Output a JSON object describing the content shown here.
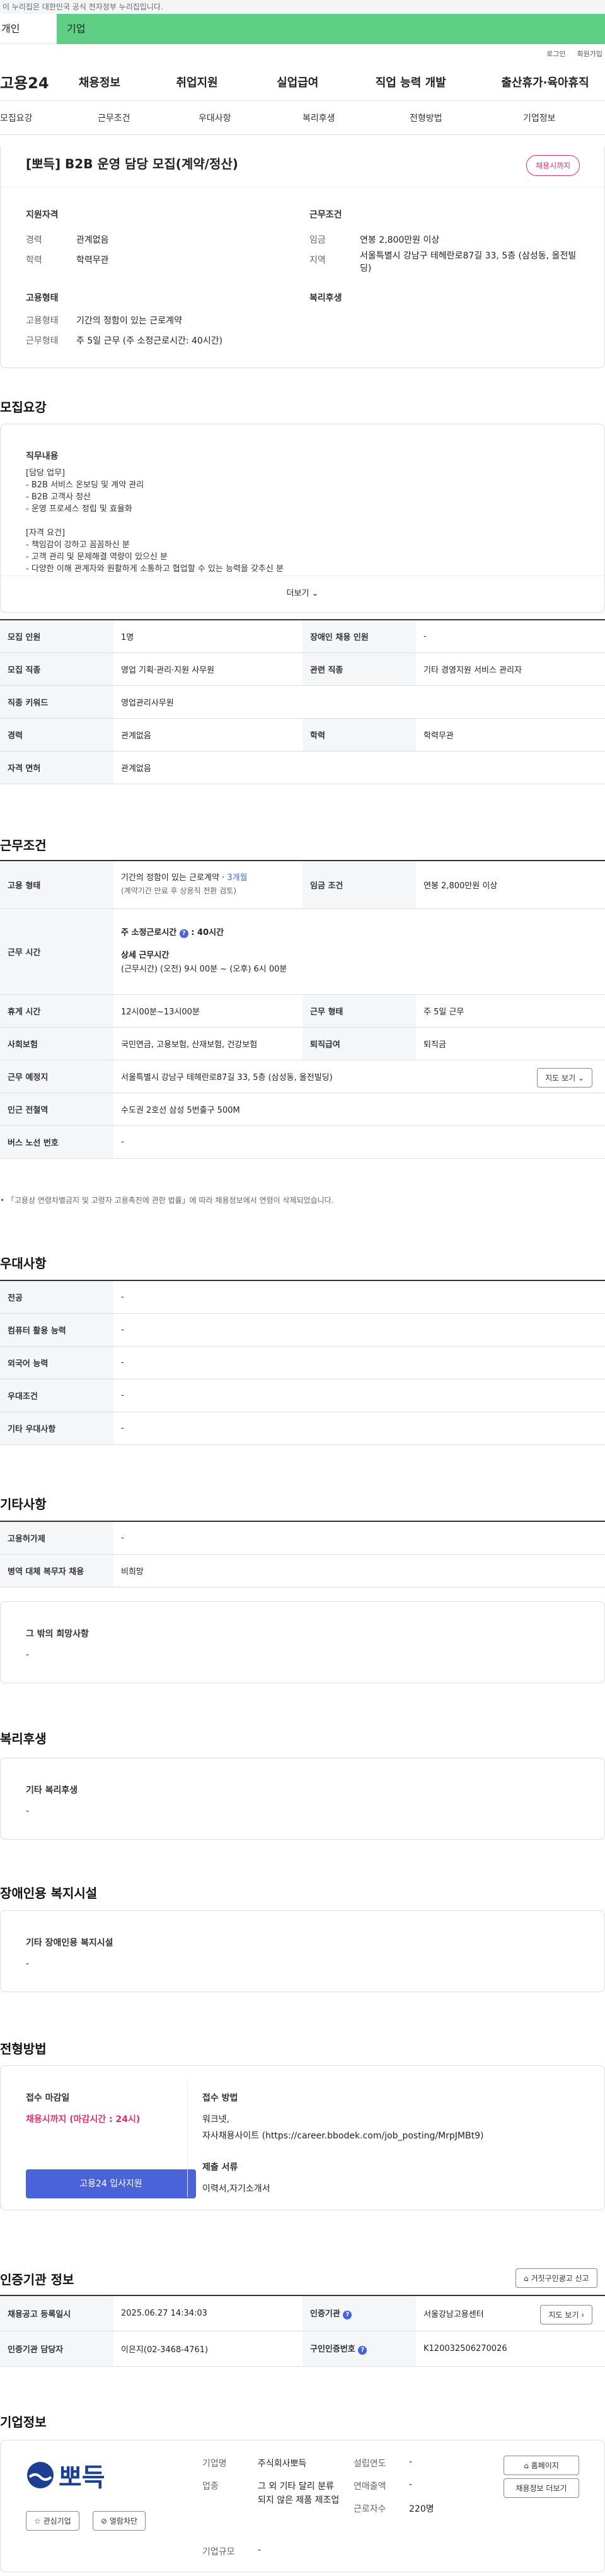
{
  "gov_banner": "이 누리집은 대한민국 공식 전자정부 누리집입니다.",
  "tabs": {
    "individual": "개인",
    "enterprise": "기업"
  },
  "util": {
    "login": "로그인",
    "signup": "회원가입"
  },
  "gnb": {
    "logo": "고용24",
    "items": [
      "채용정보",
      "취업지원",
      "실업급여",
      "직업 능력 개발",
      "출산휴가·육아휴직"
    ]
  },
  "subnav": [
    "모집요강",
    "근무조건",
    "우대사항",
    "복리후생",
    "전형방법",
    "기업정보"
  ],
  "summary": {
    "title": "[뽀득] B2B 운영 담당 모집(계약/정산)",
    "badge": "채용시까지",
    "qual_label": "지원자격",
    "exp_key": "경력",
    "exp_val": "관계없음",
    "edu_key": "학력",
    "edu_val": "학력무관",
    "cond_label": "근무조건",
    "wage_key": "임금",
    "wage_val": "연봉 2,800만원 이상",
    "loc_key": "지역",
    "loc_val": "서울특별시 강남구 테헤란로87길 33, 5층 (삼성동, 올전빌딩)",
    "emp_label": "고용형태",
    "type_key": "고용형태",
    "type_val": "기간의 정함이 있는 근로계약",
    "form_key": "근무형태",
    "form_val": "주 5일 근무 (주 소정근로시간: 40시간)",
    "welfare_label": "복리후생"
  },
  "recruit": {
    "title": "모집요강",
    "duty_label": "직무내용",
    "lines": [
      "[담당 업무]",
      "- B2B 서비스 온보딩 및 계약 관리",
      "- B2B 고객사 정산",
      "- 운영 프로세스 정립 및 효율화",
      "",
      "[자격 요건]",
      "- 책임감이 강하고 꼼꼼하신 분",
      "- 고객 관리 및 문제해결 역량이 있으신 분",
      "- 다양한 이해 관계자와 원활하게 소통하고 협업할 수 있는 능력을 갖추신 분"
    ],
    "more": "더보기",
    "rows": [
      {
        "k1": "모집 인원",
        "v1": "1명",
        "k2": "장애인 채용 인원",
        "v2": "-"
      },
      {
        "k1": "모집 직종",
        "v1": "영업 기획·관리·지원 사무원",
        "k2": "관련 직종",
        "v2": "기타 경영지원 서비스 관리자"
      },
      {
        "k1": "직종 키워드",
        "v1": "영업관리사무원"
      },
      {
        "k1": "경력",
        "v1": "관계없음",
        "k2": "학력",
        "v2": "학력무관"
      },
      {
        "k1": "자격 면허",
        "v1": "관계없음"
      }
    ]
  },
  "work": {
    "title": "근무조건",
    "emp_key": "고용 형태",
    "emp_val1": "기간의 정함이 있는 근로계약 · ",
    "emp_month": "3개월",
    "emp_val2": "(계약기간 만료 후 상용직 전환 검토)",
    "wage_key": "임금 조건",
    "wage_val": "연봉 2,800만원 이상",
    "hours_key": "근무 시간",
    "hours_week": "주 소정근로시간",
    "hours_week_val": "40시간",
    "hours_detail_label": "상세 근무시간",
    "hours_detail": "(근무시간) (오전) 9시 00분 ~ (오후) 6시 00분",
    "break_key": "휴게 시간",
    "break_val": "12시00분~13시00분",
    "form_key": "근무 형태",
    "form_val": "주 5일 근무",
    "ins_key": "사회보험",
    "ins_val": "국민연금, 고용보험, 산재보험, 건강보험",
    "ret_key": "퇴직급여",
    "ret_val": "퇴직금",
    "place_key": "근무 예정지",
    "place_val": "서울특별시 강남구 테헤란로87길 33, 5층 (삼성동, 올전빌딩)",
    "map_btn": "지도 보기",
    "subway_key": "인근 전철역",
    "subway_val": "수도권 2호선 삼성 5번출구 500M",
    "bus_key": "버스 노선 번호",
    "bus_val": "-",
    "note": "「고용상 연령차별금지 및 고령자 고용촉진에 관한 법률」에 따라 채용정보에서 연령이 삭제되었습니다."
  },
  "pref": {
    "title": "우대사항",
    "rows": [
      {
        "k": "전공",
        "v": "-"
      },
      {
        "k": "컴퓨터 활용 능력",
        "v": "-"
      },
      {
        "k": "외국어 능력",
        "v": "-"
      },
      {
        "k": "우대조건",
        "v": "-"
      },
      {
        "k": "기타 우대사항",
        "v": "-"
      }
    ]
  },
  "etc": {
    "title": "기타사항",
    "rows": [
      {
        "k": "고용허가제",
        "v": "-"
      },
      {
        "k": "병역 대체 복무자 채용",
        "v": "비희망"
      }
    ],
    "other_label": "그 밖의 희망사항",
    "other_val": "-"
  },
  "welfare": {
    "title": "복리후생",
    "label": "기타 복리후생",
    "val": "-"
  },
  "disab": {
    "title": "장애인용 복지시설",
    "label": "기타 장애인용 복지시설",
    "val": "-"
  },
  "process": {
    "title": "전형방법",
    "deadline_label": "접수 마감일",
    "deadline_val": "채용시까지 (마감시간 : 24시)",
    "apply_btn": "고용24 입사지원",
    "method_label": "접수 방법",
    "method_val1": "워크넷,",
    "method_val2": "자사채용사이트 (https://career.bbodek.com/job_posting/MrpJMBt9)",
    "docs_label": "제출 서류",
    "docs_val": "이력서,자기소개서"
  },
  "agency": {
    "title": "인증기관 정보",
    "report_btn": "거짓구인광고 신고",
    "date_key": "채용공고 등록일시",
    "date_val": "2025.06.27 14:34:03",
    "org_key": "인증기관",
    "org_val": "서울강남고용센터",
    "map_btn": "지도 보기",
    "mgr_key": "인증기관 담당자",
    "mgr_val": "이은지(02-3468-4761)",
    "no_key": "구인인증번호",
    "no_val": "K120032506270026"
  },
  "company": {
    "title": "기업정보",
    "logo": "뽀득",
    "fav_btn": "관심기업",
    "block_btn": "열람차단",
    "name_key": "기업명",
    "name_val": "주식회사뽀득",
    "year_key": "설립연도",
    "year_val": "-",
    "ind_key": "업종",
    "ind_val": "그 외 기타 달리 분류되지 않은 제품 제조업",
    "sales_key": "연매출액",
    "sales_val": "-",
    "emp_key": "근로자수",
    "emp_val": "220명",
    "size_key": "기업규모",
    "size_val": "-",
    "home_btn": "홈페이지",
    "jobs_btn": "채용정보 더보기"
  },
  "colors": {
    "accent_green": "#5fcf85",
    "brand_blue": "#4a63d8",
    "badge_pink": "#e0306e"
  }
}
